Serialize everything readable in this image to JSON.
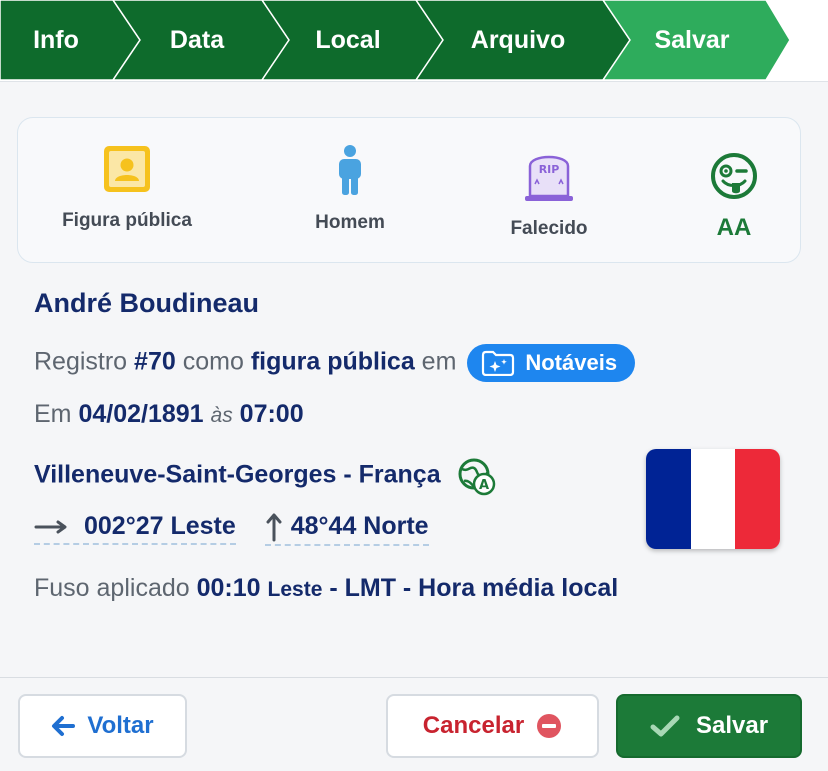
{
  "stepper": {
    "steps": [
      {
        "label": "Info"
      },
      {
        "label": "Data"
      },
      {
        "label": "Local"
      },
      {
        "label": "Arquivo"
      },
      {
        "label": "Salvar"
      }
    ],
    "colors": {
      "done": "#0e6b2c",
      "current": "#2eac5c"
    }
  },
  "summary": {
    "items": [
      {
        "label": "Figura pública",
        "icon": "public-figure-icon"
      },
      {
        "label": "Homem",
        "icon": "male-person-icon"
      },
      {
        "label": "Falecido",
        "icon": "tombstone-icon"
      },
      {
        "label": "AA",
        "icon": "winking-face-icon"
      }
    ],
    "icon_text": {
      "rip": "RIP"
    }
  },
  "details": {
    "name": "André Boudineau",
    "record_prefix": "Registro",
    "record_number": "#70",
    "record_as": "como",
    "record_type": "figura pública",
    "record_in": "em",
    "collection_badge": "Notáveis",
    "date_prefix": "Em",
    "date": "04/02/1891",
    "time_prefix": "às",
    "time": "07:00",
    "place": "Villeneuve-Saint-Georges - França",
    "geo_icon_letter": "A",
    "longitude": "002°27 Leste",
    "latitude": "48°44 Norte",
    "tz_prefix": "Fuso aplicado",
    "tz_offset": "00:10",
    "tz_direction": "Leste",
    "tz_name": "- LMT - Hora média local",
    "flag_colors": [
      "#002395",
      "#ffffff",
      "#ed2939"
    ]
  },
  "footer": {
    "back_label": "Voltar",
    "cancel_label": "Cancelar",
    "save_label": "Salvar"
  }
}
